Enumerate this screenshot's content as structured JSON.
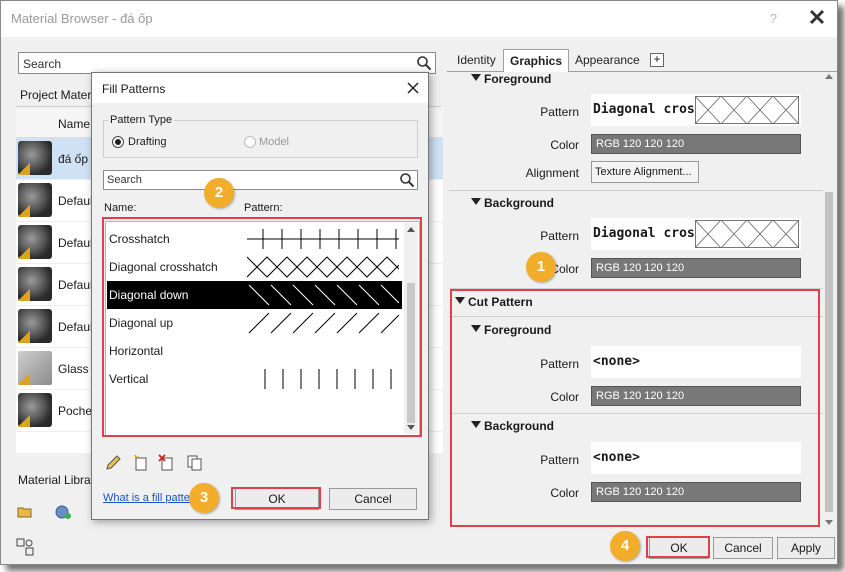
{
  "window": {
    "title": "Material Browser - đá ốp",
    "help_glyph": "?",
    "close_glyph": "✕"
  },
  "left": {
    "search_placeholder": "Search",
    "project_materials_label": "Project Mater",
    "column_name": "Name",
    "materials": [
      {
        "name": "đá ốp",
        "selected": true
      },
      {
        "name": "Defaul"
      },
      {
        "name": "Defaul"
      },
      {
        "name": "Defaul"
      },
      {
        "name": "Defaul"
      },
      {
        "name": "Glass"
      },
      {
        "name": "Poche"
      }
    ],
    "library_label": "Material Librar"
  },
  "tabs": [
    {
      "label": "Identity"
    },
    {
      "label": "Graphics",
      "active": true
    },
    {
      "label": "Appearance"
    }
  ],
  "tab_add_glyph": "+",
  "graphics": {
    "surface_foreground": {
      "header": "Foreground",
      "pattern_label": "Pattern",
      "pattern_value": "Diagonal cros…",
      "color_label": "Color",
      "color_value": "RGB 120 120 120",
      "alignment_label": "Alignment",
      "alignment_button": "Texture Alignment..."
    },
    "surface_background": {
      "header": "Background",
      "pattern_label": "Pattern",
      "pattern_value": "Diagonal cros…",
      "color_label": "Color",
      "color_value": "RGB 120 120 120"
    },
    "cut_pattern": {
      "header": "Cut Pattern",
      "foreground": {
        "header": "Foreground",
        "pattern_label": "Pattern",
        "pattern_value": "<none>",
        "color_label": "Color",
        "color_value": "RGB 120 120 120"
      },
      "background": {
        "header": "Background",
        "pattern_label": "Pattern",
        "pattern_value": "<none>",
        "color_label": "Color",
        "color_value": "RGB 120 120 120"
      }
    }
  },
  "main_buttons": {
    "ok": "OK",
    "cancel": "Cancel",
    "apply": "Apply"
  },
  "dialog": {
    "title": "Fill Patterns",
    "pattern_type_label": "Pattern Type",
    "radio_drafting": "Drafting",
    "radio_model": "Model",
    "search_placeholder": "Search",
    "col_name": "Name:",
    "col_pattern": "Pattern:",
    "patterns": [
      {
        "name": "Crosshatch",
        "kind": "crosshatch"
      },
      {
        "name": "Diagonal crosshatch",
        "kind": "diagcross"
      },
      {
        "name": "Diagonal down",
        "kind": "diagdown",
        "selected": true
      },
      {
        "name": "Diagonal up",
        "kind": "diagup"
      },
      {
        "name": "Horizontal",
        "kind": "horizontal"
      },
      {
        "name": "Vertical",
        "kind": "vertical"
      }
    ],
    "help_link": "What is a fill pattern?",
    "ok": "OK",
    "cancel": "Cancel"
  },
  "callouts": [
    "1",
    "2",
    "3",
    "4"
  ],
  "colors": {
    "callout_badge": "#f2ad2b",
    "callout_frame": "#e0404a",
    "color_swatch": "#787878",
    "selected_row": "#cfe1f4"
  }
}
